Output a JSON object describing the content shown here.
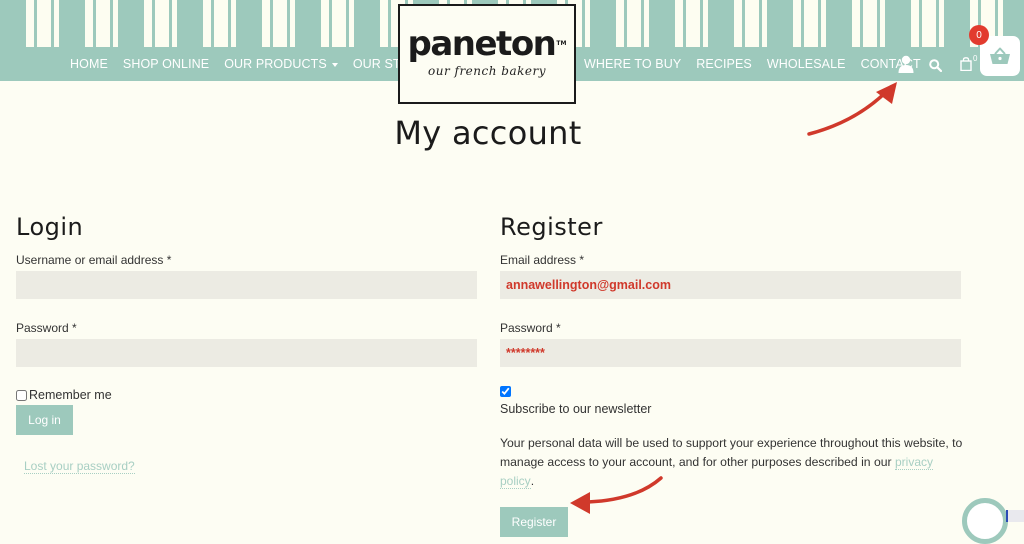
{
  "header": {
    "brand": "paneton",
    "brand_tm": "TM",
    "tagline": "our french bakery",
    "nav_left": [
      {
        "label": "HOME"
      },
      {
        "label": "SHOP ONLINE"
      },
      {
        "label": "OUR PRODUCTS",
        "has_dropdown": true
      },
      {
        "label": "OUR STORY"
      }
    ],
    "nav_right": [
      {
        "label": "WHERE TO BUY"
      },
      {
        "label": "RECIPES"
      },
      {
        "label": "WHOLESALE"
      },
      {
        "label": "CONTACT"
      }
    ],
    "icons": [
      "user-icon",
      "search-icon",
      "shopping-bag-icon"
    ],
    "bag_count": "0",
    "cart_badge_count": "0"
  },
  "page": {
    "title": "My account"
  },
  "login": {
    "heading": "Login",
    "username_label": "Username or email address *",
    "username_value": "",
    "password_label": "Password *",
    "password_value": "",
    "remember_label": "Remember me",
    "remember_checked": false,
    "submit_label": "Log in",
    "lost_password_link": "Lost your password?"
  },
  "register": {
    "heading": "Register",
    "email_label": "Email address *",
    "email_value": "annawellington@gmail.com",
    "password_label": "Password *",
    "password_value": "********",
    "newsletter_checked": true,
    "newsletter_label": "Subscribe to our newsletter",
    "privacy_text_before": "Your personal data will be used to support your experience throughout this website, to manage access to your account, and for other purposes described in our ",
    "privacy_link": "privacy policy",
    "privacy_text_after": ".",
    "submit_label": "Register"
  },
  "colors": {
    "brand_teal": "#9dc9bc",
    "background_cream": "#fdfdf3",
    "input_bg": "#ecebe3",
    "annotation_red": "#d0392b",
    "badge_red": "#e23b2e"
  }
}
